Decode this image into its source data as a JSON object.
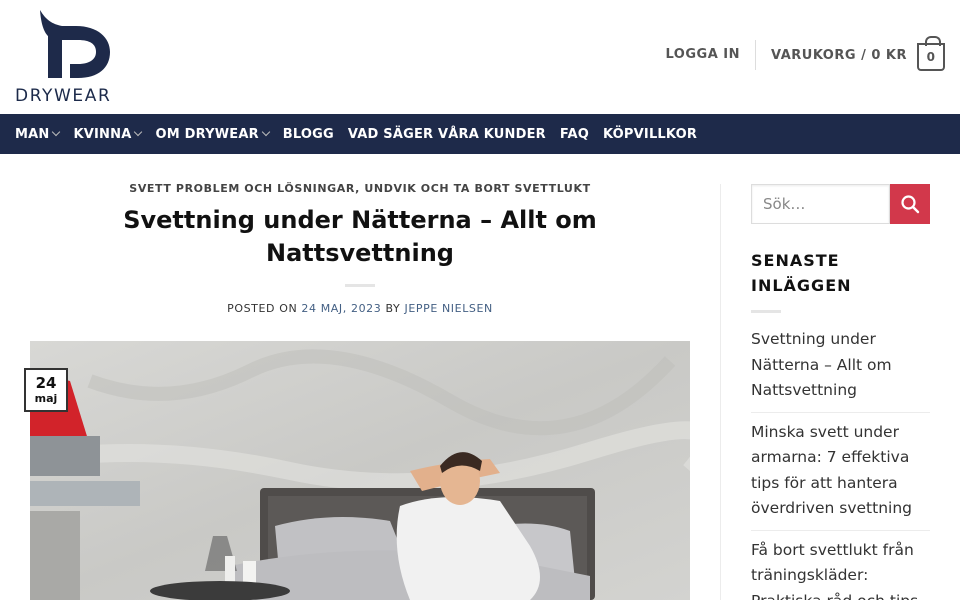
{
  "brand": {
    "name": "DRYWEAR",
    "color": "#1e2a4a",
    "accent": "#d2384b"
  },
  "header": {
    "login_label": "LOGGA IN",
    "cart_label": "VARUKORG / 0 KR",
    "cart_count": "0"
  },
  "nav": {
    "items": [
      {
        "label": "MAN",
        "has_dropdown": true
      },
      {
        "label": "KVINNA",
        "has_dropdown": true
      },
      {
        "label": "OM DRYWEAR",
        "has_dropdown": true
      },
      {
        "label": "BLOGG",
        "has_dropdown": false
      },
      {
        "label": "VAD SÄGER VÅRA KUNDER",
        "has_dropdown": false
      },
      {
        "label": "FAQ",
        "has_dropdown": false
      },
      {
        "label": "KÖPVILLKOR",
        "has_dropdown": false
      }
    ]
  },
  "article": {
    "category": "SVETT PROBLEM OCH LÖSNINGAR, UNDVIK OCH TA BORT SVETTLUKT",
    "title": "Svettning under Nätterna – Allt om Nattsvettning",
    "posted_on_label": "POSTED ON",
    "date": "24 MAJ, 2023",
    "by_label": "BY",
    "author": "JEPPE NIELSEN",
    "badge_day": "24",
    "badge_month": "maj"
  },
  "sidebar": {
    "search_placeholder": "Sök…",
    "recent_title": "SENASTE INLÄGGEN",
    "recent_posts": [
      "Svettning under Nätterna – Allt om Nattsvettning",
      "Minska svett under armarna: 7 effektiva tips för att hantera överdriven svettning",
      "Få bort svettlukt från träningskläder: Praktiska råd och tips"
    ]
  }
}
